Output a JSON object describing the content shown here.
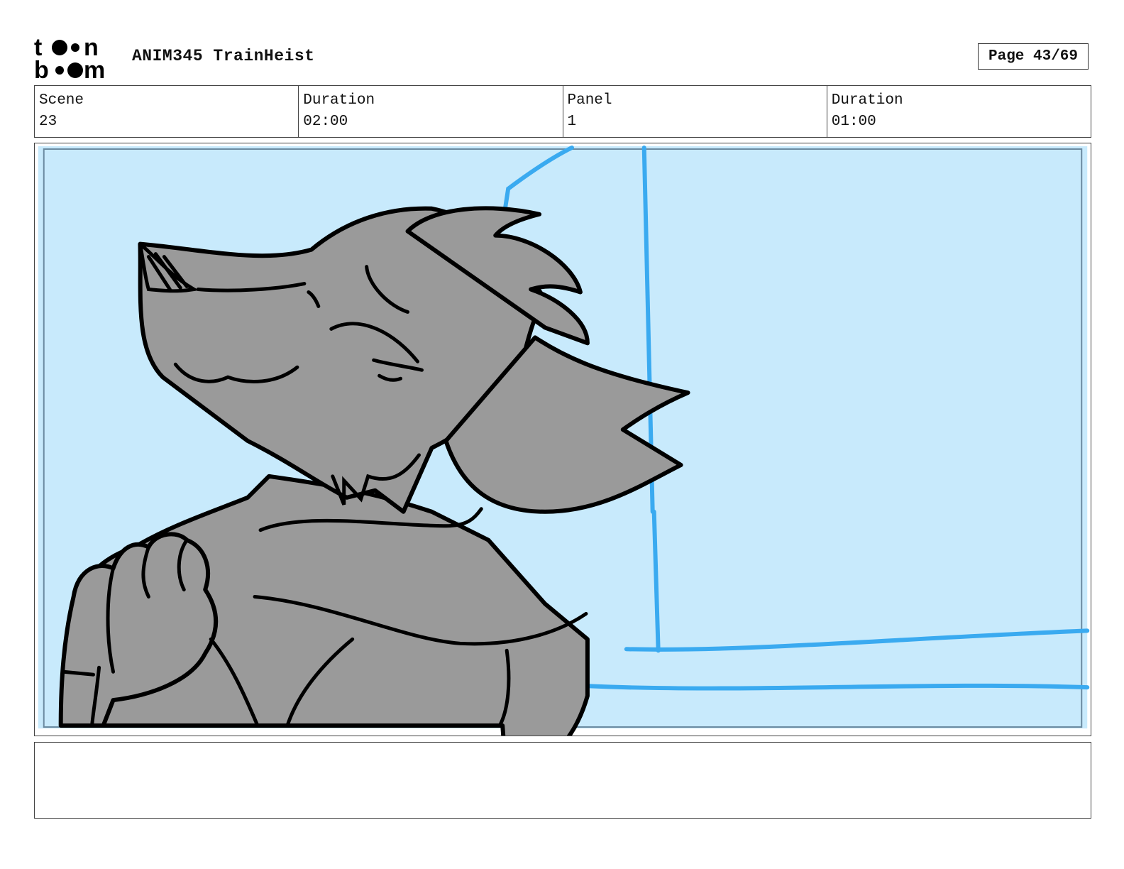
{
  "header": {
    "logo_line1": "toon",
    "logo_line2": "boom",
    "project_title": "ANIM345 TrainHeist",
    "page_label": "Page 43/69"
  },
  "info": [
    {
      "label": "Scene",
      "value": "23"
    },
    {
      "label": "Duration",
      "value": "02:00"
    },
    {
      "label": "Panel",
      "value": "1"
    },
    {
      "label": "Duration",
      "value": "01:00"
    }
  ],
  "panel": {
    "background_color": "#c8eafc",
    "guide_line_color": "#3aaaf0",
    "character_fill_color": "#9a9a9a",
    "ink_color": "#000000"
  },
  "notes": {
    "text": ""
  }
}
